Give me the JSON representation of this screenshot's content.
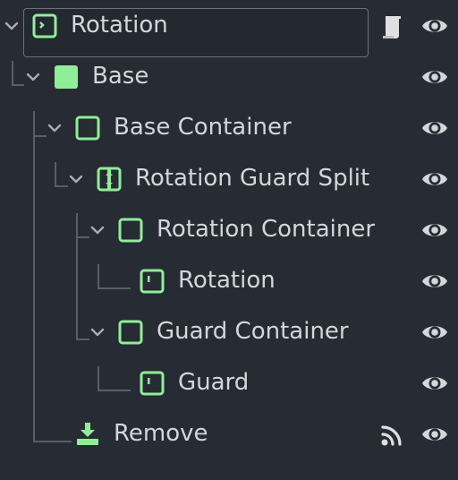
{
  "scene_tree": {
    "nodes": [
      {
        "label": "Rotation",
        "icon": "margin-container-icon",
        "expanded": true,
        "selected": true,
        "extra": "script-icon"
      },
      {
        "label": "Base",
        "icon": "color-rect-icon",
        "expanded": true
      },
      {
        "label": "Base Container",
        "icon": "container-icon",
        "expanded": true
      },
      {
        "label": "Rotation Guard Split",
        "icon": "split-container-icon",
        "expanded": true
      },
      {
        "label": "Rotation Container",
        "icon": "container-icon",
        "expanded": true
      },
      {
        "label": "Rotation",
        "icon": "margin-container-icon"
      },
      {
        "label": "Guard Container",
        "icon": "container-icon",
        "expanded": true
      },
      {
        "label": "Guard",
        "icon": "margin-container-icon"
      },
      {
        "label": "Remove",
        "icon": "remove-icon",
        "extra": "signal-icon"
      }
    ]
  },
  "colors": {
    "background": "#272b33",
    "node_icon": "#8eef97",
    "text": "#d4d6da",
    "eye": "#d4d6da",
    "guide": "#5a5e66"
  }
}
